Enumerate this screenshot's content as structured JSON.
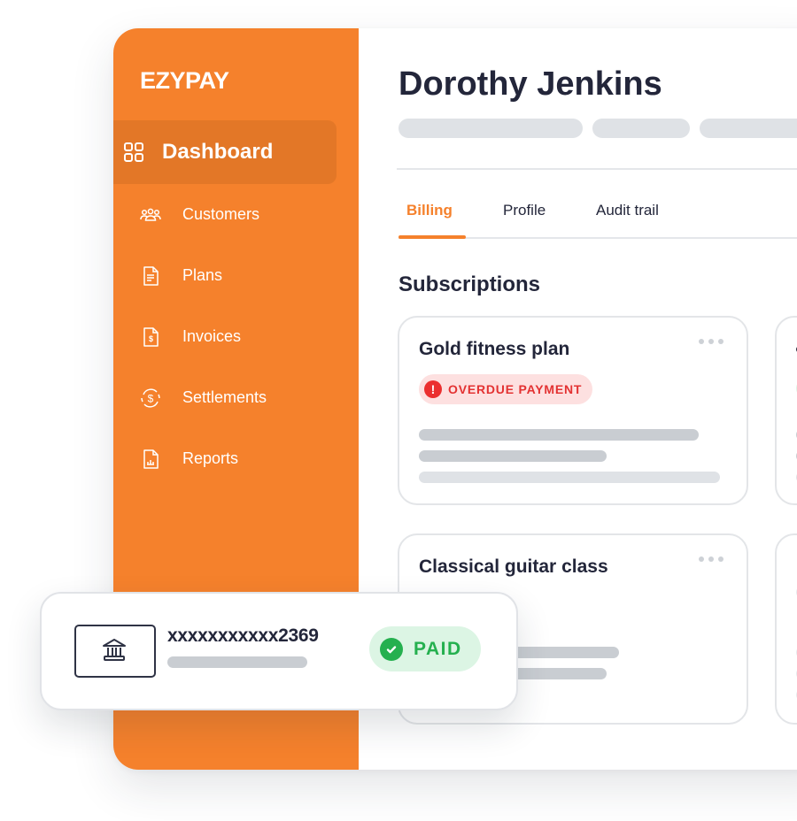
{
  "app": {
    "brand": "EZYPAY"
  },
  "sidebar": {
    "active_item": {
      "label": "Dashboard",
      "icon": "dashboard-grid-icon"
    },
    "items": [
      {
        "label": "Customers",
        "icon": "users-icon"
      },
      {
        "label": "Plans",
        "icon": "document-icon"
      },
      {
        "label": "Invoices",
        "icon": "invoice-dollar-icon"
      },
      {
        "label": "Settlements",
        "icon": "dollar-cycle-icon"
      },
      {
        "label": "Reports",
        "icon": "report-chart-icon"
      }
    ]
  },
  "header": {
    "customer_name": "Dorothy Jenkins"
  },
  "tabs": [
    {
      "label": "Billing",
      "active": true
    },
    {
      "label": "Profile",
      "active": false
    },
    {
      "label": "Audit trail",
      "active": false
    }
  ],
  "subscriptions": {
    "title": "Subscriptions",
    "cards": [
      {
        "name": "Gold fitness plan",
        "status": "OVERDUE PAYMENT",
        "status_color": "#e33232"
      },
      {
        "name": "Classical guitar class",
        "status": "",
        "status_color": ""
      }
    ]
  },
  "payment_method": {
    "account": "xxxxxxxxxxx2369",
    "icon": "bank-icon",
    "status": "PAID",
    "status_color": "#25b04f"
  },
  "colors": {
    "brand": "#f5812c",
    "text": "#23263a",
    "danger": "#e33232",
    "success": "#25b04f"
  }
}
